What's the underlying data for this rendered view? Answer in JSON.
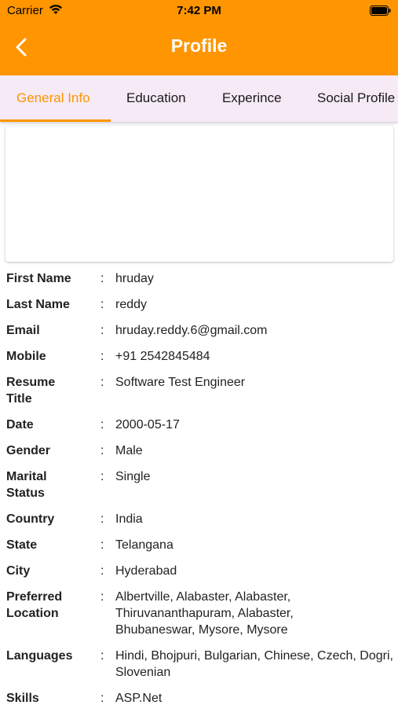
{
  "status_bar": {
    "carrier": "Carrier",
    "time": "7:42 PM"
  },
  "app_bar": {
    "title": "Profile",
    "back_icon": "chevron-left-icon"
  },
  "tabs": [
    {
      "label": "General Info",
      "active": true
    },
    {
      "label": "Education",
      "active": false
    },
    {
      "label": "Experince",
      "active": false
    },
    {
      "label": "Social Profile",
      "active": false
    }
  ],
  "profile": {
    "rows": [
      {
        "label": "First Name",
        "value": "hruday"
      },
      {
        "label": "Last Name",
        "value": "reddy"
      },
      {
        "label": "Email",
        "value": "hruday.reddy.6@gmail.com"
      },
      {
        "label": "Mobile",
        "value": "+91 2542845484"
      },
      {
        "label": "Resume Title",
        "value": "Software Test Engineer"
      },
      {
        "label": "Date",
        "value": "2000-05-17"
      },
      {
        "label": "Gender",
        "value": "Male"
      },
      {
        "label": "Marital Status",
        "value": "Single"
      },
      {
        "label": "Country",
        "value": "India"
      },
      {
        "label": "State",
        "value": "Telangana"
      },
      {
        "label": "City",
        "value": "Hyderabad"
      },
      {
        "label": "Preferred Location",
        "value": "Albertville, Alabaster, Alabaster, Thiruvananthapuram, Alabaster, Bhubaneswar, Mysore, Mysore"
      },
      {
        "label": "Languages",
        "value": "Hindi, Bhojpuri, Bulgarian, Chinese, Czech, Dogri, Slovenian"
      },
      {
        "label": "Skills",
        "value": "ASP.Net"
      }
    ],
    "separator": ":"
  },
  "colors": {
    "accent": "#ff9500",
    "tab_bar_bg": "#f5eaf5"
  }
}
